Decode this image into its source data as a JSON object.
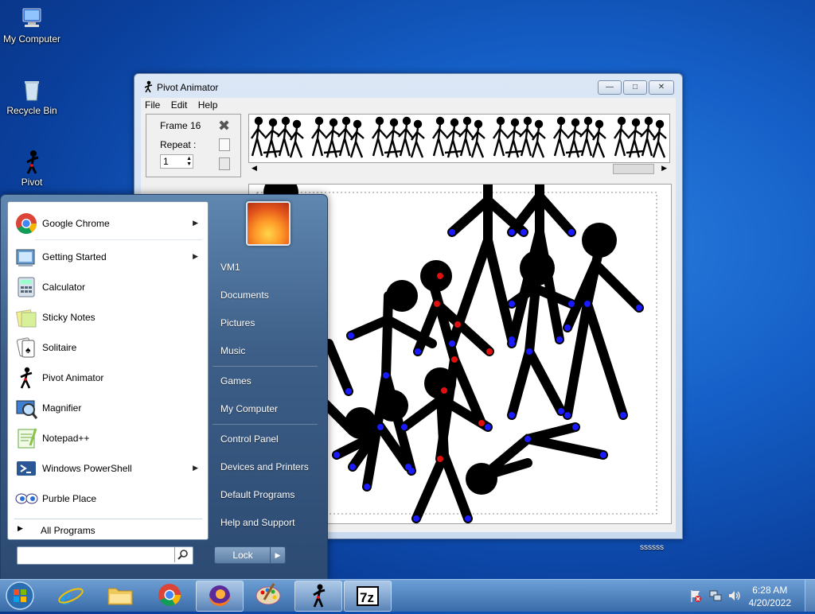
{
  "desktop": {
    "icons": [
      {
        "label": "My Computer"
      },
      {
        "label": "Recycle Bin"
      },
      {
        "label": "Pivot"
      }
    ],
    "corner_text": "ssssss"
  },
  "window": {
    "title": "Pivot Animator",
    "menu": [
      "File",
      "Edit",
      "Help"
    ],
    "frame_label": "Frame 16",
    "repeat_label": "Repeat :",
    "repeat_value": "1"
  },
  "start_menu": {
    "programs": [
      {
        "label": "Google Chrome",
        "icon": "chrome-icon",
        "submenu": true
      },
      {
        "label": "Getting Started",
        "icon": "getting-started-icon",
        "submenu": true
      },
      {
        "label": "Calculator",
        "icon": "calculator-icon",
        "submenu": false
      },
      {
        "label": "Sticky Notes",
        "icon": "sticky-notes-icon",
        "submenu": false
      },
      {
        "label": "Solitaire",
        "icon": "solitaire-icon",
        "submenu": false
      },
      {
        "label": "Pivot Animator",
        "icon": "pivot-icon",
        "submenu": false
      },
      {
        "label": "Magnifier",
        "icon": "magnifier-icon",
        "submenu": false
      },
      {
        "label": "Notepad++",
        "icon": "notepadpp-icon",
        "submenu": false
      },
      {
        "label": "Windows PowerShell",
        "icon": "powershell-icon",
        "submenu": true
      },
      {
        "label": "Purble Place",
        "icon": "purble-place-icon",
        "submenu": false
      }
    ],
    "all_programs": "All Programs",
    "search_placeholder": "",
    "right": [
      "VM1",
      "Documents",
      "Pictures",
      "Music",
      "Games",
      "My Computer",
      "Control Panel",
      "Devices and Printers",
      "Default Programs",
      "Help and Support"
    ],
    "lock_label": "Lock"
  },
  "taskbar": {
    "items": [
      "start-orb",
      "internet-explorer",
      "file-explorer",
      "chrome",
      "firefox",
      "paint",
      "pivot-animator",
      "7-zip"
    ],
    "time": "6:28 AM",
    "date": "4/20/2022"
  },
  "colors": {
    "accent": "#1560c8",
    "joint_blue": "#1a1aff",
    "joint_red": "#e01010"
  }
}
